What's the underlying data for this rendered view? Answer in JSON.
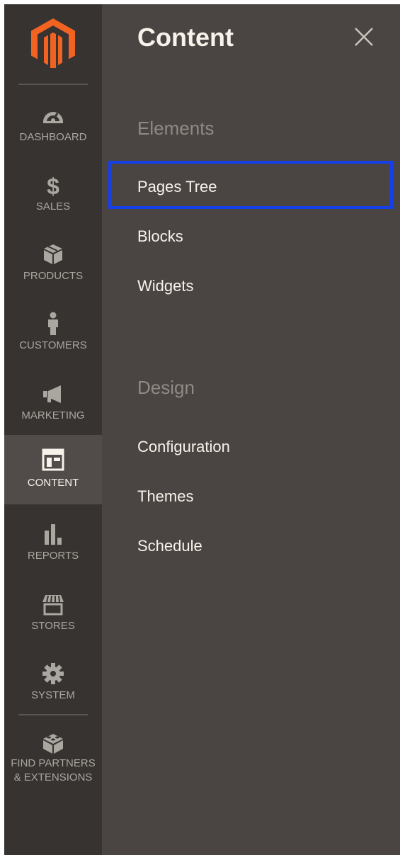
{
  "sidebar": {
    "items": [
      {
        "label": "DASHBOARD",
        "icon": "dashboard-icon"
      },
      {
        "label": "SALES",
        "icon": "dollar-icon"
      },
      {
        "label": "PRODUCTS",
        "icon": "cube-icon"
      },
      {
        "label": "CUSTOMERS",
        "icon": "person-icon"
      },
      {
        "label": "MARKETING",
        "icon": "megaphone-icon"
      },
      {
        "label": "CONTENT",
        "icon": "layout-icon",
        "active": true
      },
      {
        "label": "REPORTS",
        "icon": "bar-chart-icon"
      },
      {
        "label": "STORES",
        "icon": "storefront-icon"
      },
      {
        "label": "SYSTEM",
        "icon": "gear-icon"
      },
      {
        "label_line1": "FIND PARTNERS",
        "label_line2": "& EXTENSIONS",
        "icon": "blocks-icon"
      }
    ]
  },
  "panel": {
    "title": "Content",
    "close_icon": "close-icon",
    "sections": [
      {
        "title": "Elements",
        "links": [
          "Pages Tree",
          "Blocks",
          "Widgets"
        ]
      },
      {
        "title": "Design",
        "links": [
          "Configuration",
          "Themes",
          "Schedule"
        ]
      }
    ],
    "highlighted_link": "Pages Tree"
  },
  "colors": {
    "sidebar_bg": "#373330",
    "panel_bg": "#4a4542",
    "active_item_bg": "#514c49",
    "logo_orange": "#f26322",
    "highlight_border": "#1640e8",
    "text_light": "#f7f3eb",
    "text_muted": "#aaa6a0",
    "section_title": "#8e8a85"
  }
}
